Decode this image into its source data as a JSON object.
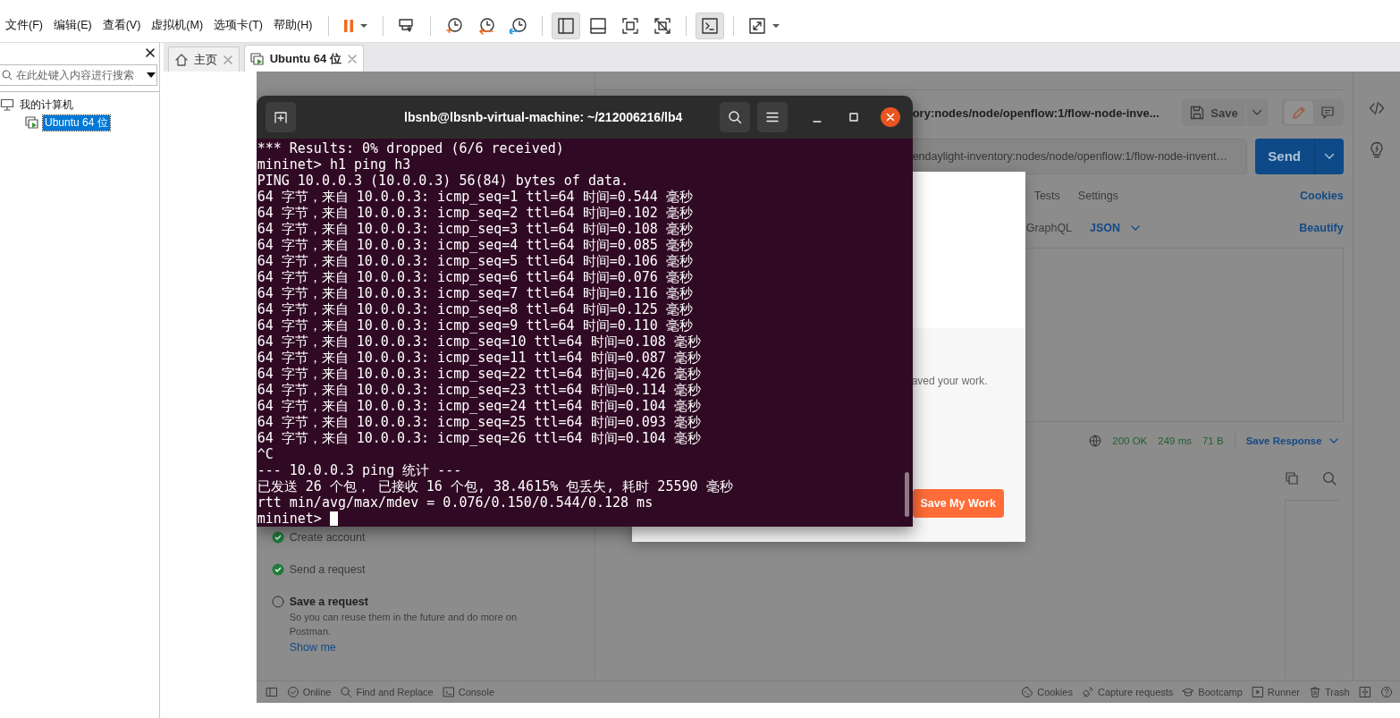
{
  "menu": [
    "文件(F)",
    "编辑(E)",
    "查看(V)",
    "虚拟机(M)",
    "选项卡(T)",
    "帮助(H)"
  ],
  "toolbar": [
    {
      "kind": "pause",
      "selected": false
    },
    {
      "kind": "send-keys",
      "selected": false
    },
    {
      "kind": "snapshot-take",
      "selected": false
    },
    {
      "kind": "snapshot-revert",
      "selected": false
    },
    {
      "kind": "snapshot-manager",
      "selected": false
    },
    {
      "kind": "sidebar-view",
      "selected": true
    },
    {
      "kind": "thumbnail-view",
      "selected": false
    },
    {
      "kind": "fullscreen",
      "selected": false
    },
    {
      "kind": "unity",
      "selected": false
    },
    {
      "kind": "console-view",
      "selected": true
    },
    {
      "kind": "stretch",
      "selected": false
    }
  ],
  "library": {
    "search": {
      "placeholder": "在此处键入内容进行搜索"
    },
    "tree": [
      {
        "label": "我的计算机",
        "selected": false,
        "children": [
          {
            "label": "Ubuntu 64 位",
            "selected": true
          }
        ]
      }
    ]
  },
  "tabs": [
    {
      "label": "主页",
      "kind": "home",
      "selected": false
    },
    {
      "label": "Ubuntu 64 位",
      "kind": "vm",
      "selected": true
    }
  ],
  "postman": {
    "request_title": "ory:nodes/node/openflow:1/flow-node-inve...",
    "save": "Save",
    "mode_toggle": [
      {
        "kind": "edit",
        "selected": true
      },
      {
        "kind": "comment",
        "selected": false
      }
    ],
    "url": "endaylight-inventory:nodes/node/openflow:1/flow-node-invent…",
    "send": "Send",
    "request_tabs": [
      {
        "label": "Tests",
        "selected": false
      },
      {
        "label": "Settings",
        "selected": false
      }
    ],
    "cookies": "Cookies",
    "body_type": "GraphQL",
    "format": "JSON",
    "beautify": "Beautify",
    "response": {
      "status": "200 OK",
      "time": "249 ms",
      "size": "71 B",
      "save": "Save Response"
    },
    "checklist": [
      {
        "label": "Create account",
        "done": true
      },
      {
        "label": "Send a request",
        "done": true
      },
      {
        "label": "Save a request",
        "done": false,
        "description": "So you can reuse them in the future and do more on Postman.",
        "link": "Show me"
      }
    ],
    "status_left": [
      {
        "kind": "sidebar"
      },
      {
        "kind": "online",
        "label": "Online"
      },
      {
        "kind": "find",
        "label": "Find and Replace"
      },
      {
        "kind": "console",
        "label": "Console"
      }
    ],
    "status_right": [
      {
        "kind": "cookies",
        "label": "Cookies"
      },
      {
        "kind": "capture",
        "label": "Capture requests"
      },
      {
        "kind": "bootcamp",
        "label": "Bootcamp"
      },
      {
        "kind": "runner",
        "label": "Runner"
      },
      {
        "kind": "trash",
        "label": "Trash"
      },
      {
        "kind": "panes"
      },
      {
        "kind": "help"
      }
    ]
  },
  "modal": {
    "text": "aved your work.",
    "button": "Save My Work"
  },
  "terminal": {
    "title": "lbsnb@lbsnb-virtual-machine: ~/212006216/lb4",
    "lines": [
      "*** Results: 0% dropped (6/6 received)",
      "mininet> h1 ping h3",
      "PING 10.0.0.3 (10.0.0.3) 56(84) bytes of data.",
      "64 字节，来自 10.0.0.3: icmp_seq=1 ttl=64 时间=0.544 毫秒",
      "64 字节，来自 10.0.0.3: icmp_seq=2 ttl=64 时间=0.102 毫秒",
      "64 字节，来自 10.0.0.3: icmp_seq=3 ttl=64 时间=0.108 毫秒",
      "64 字节，来自 10.0.0.3: icmp_seq=4 ttl=64 时间=0.085 毫秒",
      "64 字节，来自 10.0.0.3: icmp_seq=5 ttl=64 时间=0.106 毫秒",
      "64 字节，来自 10.0.0.3: icmp_seq=6 ttl=64 时间=0.076 毫秒",
      "64 字节，来自 10.0.0.3: icmp_seq=7 ttl=64 时间=0.116 毫秒",
      "64 字节，来自 10.0.0.3: icmp_seq=8 ttl=64 时间=0.125 毫秒",
      "64 字节，来自 10.0.0.3: icmp_seq=9 ttl=64 时间=0.110 毫秒",
      "64 字节，来自 10.0.0.3: icmp_seq=10 ttl=64 时间=0.108 毫秒",
      "64 字节，来自 10.0.0.3: icmp_seq=11 ttl=64 时间=0.087 毫秒",
      "64 字节，来自 10.0.0.3: icmp_seq=22 ttl=64 时间=0.426 毫秒",
      "64 字节，来自 10.0.0.3: icmp_seq=23 ttl=64 时间=0.114 毫秒",
      "64 字节，来自 10.0.0.3: icmp_seq=24 ttl=64 时间=0.104 毫秒",
      "64 字节，来自 10.0.0.3: icmp_seq=25 ttl=64 时间=0.093 毫秒",
      "64 字节，来自 10.0.0.3: icmp_seq=26 ttl=64 时间=0.104 毫秒",
      "^C",
      "--- 10.0.0.3 ping 统计 ---",
      "已发送 26 个包， 已接收 16 个包, 38.4615% 包丢失, 耗时 25590 毫秒",
      "rtt min/avg/max/mdev = 0.076/0.150/0.544/0.128 ms"
    ],
    "prompt": "mininet> "
  }
}
